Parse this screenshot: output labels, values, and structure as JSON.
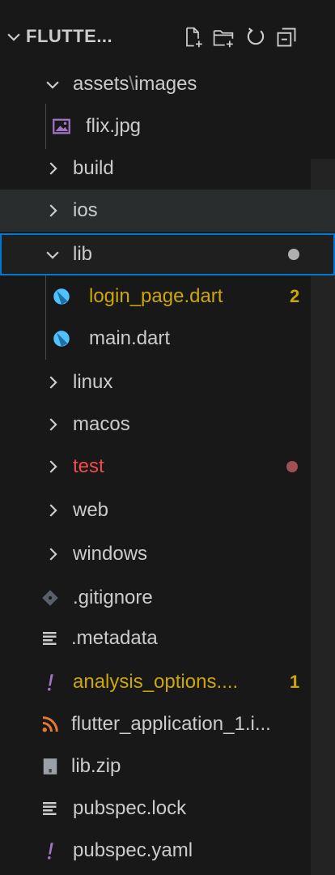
{
  "explorer": {
    "title": "FLUTTE...",
    "header_icons": [
      "new-file-icon",
      "new-folder-icon",
      "refresh-icon",
      "collapse-all-icon"
    ]
  },
  "tree": {
    "assets": {
      "label": "assets",
      "sep": "\\",
      "sub": "images"
    },
    "flix": {
      "label": "flix.jpg"
    },
    "build": {
      "label": "build"
    },
    "ios": {
      "label": "ios"
    },
    "lib": {
      "label": "lib"
    },
    "login_page": {
      "label": "login_page.dart",
      "badge": "2"
    },
    "main": {
      "label": "main.dart"
    },
    "linux": {
      "label": "linux"
    },
    "macos": {
      "label": "macos"
    },
    "test": {
      "label": "test"
    },
    "web": {
      "label": "web"
    },
    "windows": {
      "label": "windows"
    },
    "gitignore": {
      "label": ".gitignore"
    },
    "metadata": {
      "label": ".metadata"
    },
    "analysis": {
      "label": "analysis_options....",
      "badge": "1"
    },
    "iml": {
      "label": "flutter_application_1.i..."
    },
    "libzip": {
      "label": "lib.zip"
    },
    "pubspec_lock": {
      "label": "pubspec.lock"
    },
    "pubspec_yaml": {
      "label": "pubspec.yaml"
    }
  },
  "colors": {
    "background": "#181818",
    "text": "#cccccc",
    "warning_yellow": "#cca700",
    "error_red": "#f14c4c",
    "selection_border": "#0078d4",
    "dart_blue": "#4fc1ff",
    "rss_orange": "#e37933",
    "yaml_purple": "#a074c4"
  }
}
